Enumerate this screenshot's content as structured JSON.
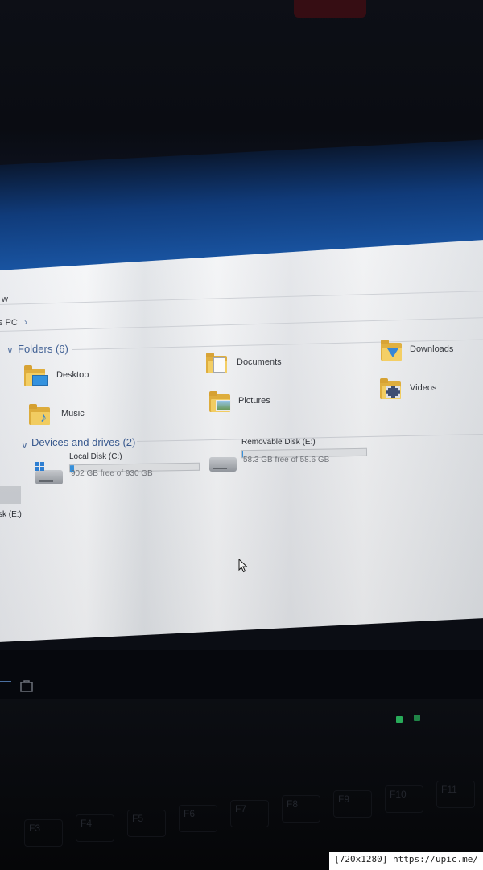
{
  "breadcrumb": {
    "current": "s PC",
    "separator": "›"
  },
  "ribbon_fragment": "w",
  "folders": {
    "title": "Folders (6)",
    "items": [
      {
        "label": "Desktop",
        "icon": "desktop-folder-icon"
      },
      {
        "label": "Documents",
        "icon": "documents-folder-icon"
      },
      {
        "label": "Downloads",
        "icon": "downloads-folder-icon"
      },
      {
        "label": "Music",
        "icon": "music-folder-icon"
      },
      {
        "label": "Pictures",
        "icon": "pictures-folder-icon"
      },
      {
        "label": "Videos",
        "icon": "videos-folder-icon"
      }
    ]
  },
  "devices": {
    "title": "Devices and drives (2)",
    "items": [
      {
        "label": "Local Disk (C:)",
        "free": "902 GB free of 930 GB",
        "used_fraction": 0.03
      },
      {
        "label": "Removable Disk (E:)",
        "free": "58.3 GB free of 58.6 GB",
        "used_fraction": 0.005
      }
    ]
  },
  "nav_pane": {
    "drive_label": "sk (E:)"
  },
  "keys": [
    "F3",
    "F4",
    "F5",
    "F6",
    "F7",
    "F8",
    "F9",
    "F10",
    "F11"
  ],
  "watermark": "[720x1280] https://upic.me/",
  "colors": {
    "accent": "#2a8de0",
    "group_title": "#2b4f8a",
    "folder": "#f7cd55",
    "wallpaper": "#1a57a6"
  }
}
